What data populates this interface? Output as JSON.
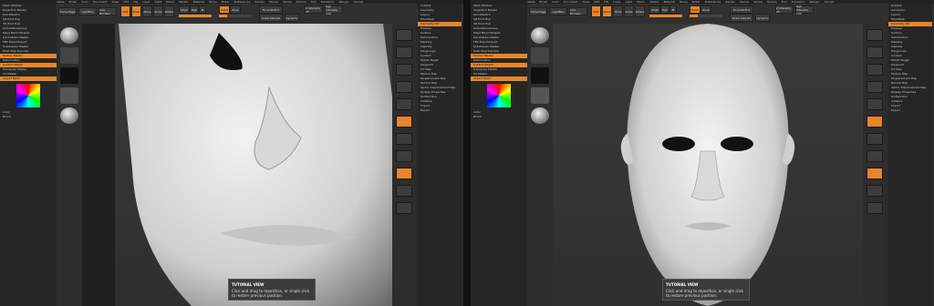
{
  "menus": [
    "Alpha",
    "Brush",
    "Color",
    "Document",
    "Draw",
    "Edit",
    "File",
    "Layer",
    "Light",
    "Macro",
    "Marker",
    "Material",
    "Movie",
    "Picker",
    "Preferences",
    "Render",
    "Stencil",
    "Stroke",
    "Texture",
    "Tool",
    "Transform",
    "Zplugin",
    "Zscript"
  ],
  "toolbar": {
    "home_label": "Home Page",
    "lightbox_label": "LightBox",
    "live_boolean_label": "Live Boolean",
    "edit_label": "Edit",
    "draw_label": "Draw",
    "move_label": "Move",
    "scale_label": "Scale",
    "rotate_label": "Rotate",
    "mrgb_label": "Mrgb",
    "rgb_label": "Rgb",
    "m_label": "M",
    "zadd_label": "Zadd",
    "zsub_label": "Zsub",
    "focal_label": "Focal Shift 0",
    "draw_size_label": "Draw Size 64",
    "dynamic_label": "Dynamic",
    "tutorial_label": "TUTORIAL VIEW",
    "z_intensity_label": "Z Intensity 25",
    "rgb_intensity_label": "Rgb Intensity 100"
  },
  "left_panel_items": [
    "Mesh Utilities",
    "Projection Master",
    "QuickSketch",
    "GB Print Exp",
    "3D Print Hub",
    "Unfold/Oxvanoise",
    "Maya Blend Shapes",
    "Decimation Master",
    "FBX ExportImport",
    "Subdivision Master",
    "Multi Map Exporter",
    "Texture Master",
    "Deformation",
    "SubTool Master",
    "Transpose Master",
    "UV Master",
    "ZBrush To Photoshop"
  ],
  "left_panel_highlight": [
    "Texture Master",
    "Subtool Master",
    "Import Mesh"
  ],
  "brush_section_label": "Brush",
  "color_label": "Color",
  "right_panel_items": [
    "Subtool",
    "Geometry",
    "Layers",
    "FiberMesh",
    "Geometry HD",
    "Preview",
    "Surface",
    "Deformation",
    "Masking",
    "Visibility",
    "Polygroups",
    "Contact",
    "Morph Target",
    "Polypaint",
    "UV Map",
    "Texture Map",
    "Displacement Map",
    "Normal Map",
    "Vector Displacement Map",
    "Display Properties",
    "Unified Skin",
    "Initialize",
    "Import",
    "Export"
  ],
  "tooltip": {
    "title": "TUTORIAL VIEW",
    "text": "Click and drag to reposition, or single click to restore previous position."
  },
  "right_nav_items": [
    "Bpr",
    "SPix 3",
    "Scroll",
    "Zoom",
    "Actual",
    "AAHalf",
    "Persp",
    "Floor",
    "Local",
    "L.Sym",
    "Frame",
    "Move",
    "Scale",
    "Rotate",
    "Line Fill",
    "Transp",
    "Ghost",
    "Solo",
    "Xpose"
  ],
  "accent_color": "#e8852a",
  "window_title": "ZBrush"
}
